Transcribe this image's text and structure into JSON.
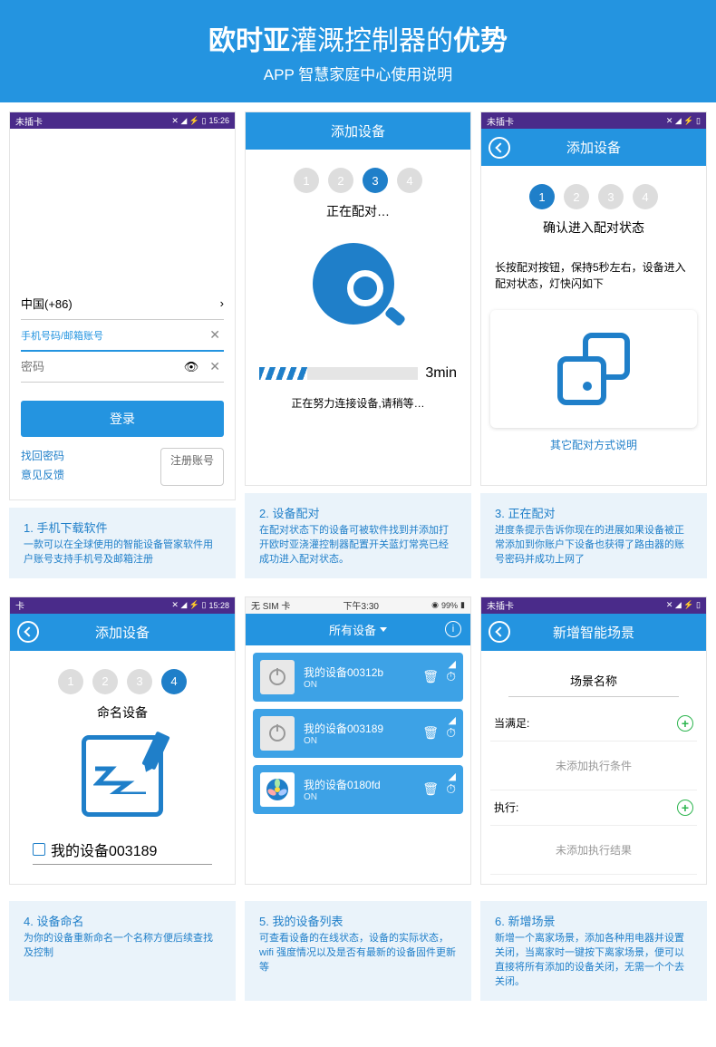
{
  "header": {
    "title_bold1": "欧时亚",
    "title_normal": "灌溉控制器的",
    "title_bold2": "优势",
    "subtitle": "APP 智慧家庭中心使用说明"
  },
  "phone1": {
    "status_left": "未插卡",
    "status_time": "15:26",
    "country": "中国(+86)",
    "country_arrow": "›",
    "phone_placeholder": "手机号码/邮箱账号",
    "pwd_placeholder": "密码",
    "login": "登录",
    "forgot": "找回密码",
    "feedback": "意见反馈",
    "register": "注册账号"
  },
  "phone2": {
    "title": "添加设备",
    "step_label": "正在配对…",
    "progress_time": "3min",
    "connecting": "正在努力连接设备,请稍等…",
    "steps": [
      "1",
      "2",
      "3",
      "4"
    ]
  },
  "phone3": {
    "status_left": "未插卡",
    "title": "添加设备",
    "step_label": "确认进入配对状态",
    "instruction": "长按配对按钮，保持5秒左右，设备进入配对状态，灯快闪如下",
    "other_method": "其它配对方式说明",
    "steps": [
      "1",
      "2",
      "3",
      "4"
    ]
  },
  "phone4": {
    "status_left": "卡",
    "status_time": "15:28",
    "title": "添加设备",
    "step_label": "命名设备",
    "device_name": "我的设备003189",
    "steps": [
      "1",
      "2",
      "3",
      "4"
    ]
  },
  "phone5": {
    "status_left": "无 SIM 卡",
    "status_center": "下午3:30",
    "status_right": "99%",
    "dropdown": "所有设备",
    "devices": [
      {
        "name": "我的设备00312b",
        "status": "ON"
      },
      {
        "name": "我的设备003189",
        "status": "ON"
      },
      {
        "name": "我的设备0180fd",
        "status": "ON"
      }
    ]
  },
  "phone6": {
    "status_left": "未插卡",
    "title": "新增智能场景",
    "scene_name_label": "场景名称",
    "when_label": "当满足:",
    "no_condition": "未添加执行条件",
    "exec_label": "执行:",
    "no_result": "未添加执行结果"
  },
  "captions": [
    {
      "title": "1. 手机下载软件",
      "body": "一款可以在全球使用的智能设备管家软件用户账号支持手机号及邮箱注册"
    },
    {
      "title": "2. 设备配对",
      "body": "在配对状态下的设备可被软件找到并添加打开欧时亚浇灌控制器配置开关蓝灯常亮已经成功进入配对状态。"
    },
    {
      "title": "3. 正在配对",
      "body": "进度条提示告诉你现在的进展如果设备被正常添加到你账户下设备也获得了路由器的账号密码并成功上网了"
    },
    {
      "title": "4. 设备命名",
      "body": "为你的设备重新命名一个名称方便后续查找及控制"
    },
    {
      "title": "5. 我的设备列表",
      "body": "可查看设备的在线状态，设备的实际状态，wifi 强度情况以及是否有最新的设备固件更新等"
    },
    {
      "title": "6. 新增场景",
      "body": "新增一个离家场景，添加各种用电器并设置关闭，当离家时一键按下离家场景，便可以直接将所有添加的设备关闭，无需一个个去关闭。"
    }
  ]
}
